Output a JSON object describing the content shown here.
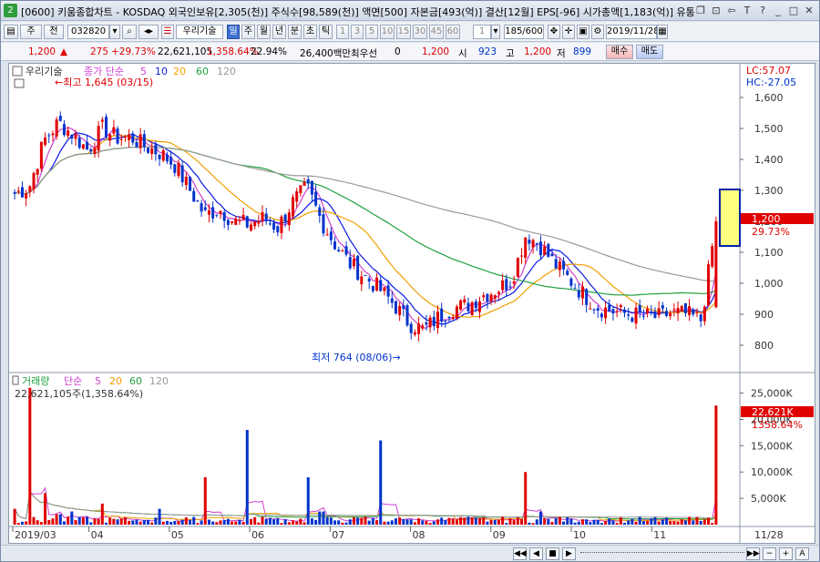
{
  "titlebar": {
    "app_num": "2",
    "title": "[0600] 키움종합차트 - KOSDAQ 외국인보유[2,305(천)] 주식수[98,589(천)] 액면[500] 자본금[493(억)] 결산[12월] EPS[-96] 시가총액[1,183(억)] 유통비율",
    "controls": [
      "❐",
      "⊡",
      "⇦",
      "T",
      "?",
      "_",
      "□",
      "✕"
    ]
  },
  "toolbar1": {
    "mode": "주",
    "prev": "전",
    "code": "032820",
    "group_label": "우리기술",
    "periods": [
      "일",
      "주",
      "월",
      "년",
      "분",
      "초",
      "틱"
    ],
    "minutes": [
      "1",
      "3",
      "5",
      "10",
      "15",
      "30",
      "45",
      "60"
    ],
    "count_select": "1",
    "count": "185/600",
    "date": "2019/11/28",
    "buy": "매수",
    "sell": "매도"
  },
  "toolbar2": {
    "price": "1,200",
    "change": "275",
    "change_pct": "+29.73%",
    "volume": "22,621,105",
    "volume_pct": "1,358.64%",
    "turnover": "22.94%",
    "trade_value": "26,400백만",
    "pref_label": "최우선",
    "pref_value": "0",
    "pref_price": "1,200",
    "open_label": "시",
    "open": "923",
    "high_label": "고",
    "high": "1,200",
    "low_label": "저",
    "low": "899"
  },
  "price_panel": {
    "name": "우리기술",
    "ma_label": "종가 단순",
    "ma_periods": [
      "5",
      "10",
      "20",
      "60",
      "120"
    ],
    "lc": "LC:57.07",
    "hc": "HC:-27.05",
    "high_note": "←최고 1,645 (03/15)",
    "low_note": "최저 764 (08/06)→",
    "current_price_label": "1,200",
    "current_pct_label": "29.73%",
    "y_ticks": [
      "1,600",
      "1,500",
      "1,400",
      "1,300",
      "1,200",
      "1,100",
      "1,000",
      "900",
      "800"
    ]
  },
  "volume_panel": {
    "name": "거래량",
    "ma_label": "단순",
    "ma_periods": [
      "5",
      "20",
      "60",
      "120"
    ],
    "summary": "22,621,105주(1,358.64%)",
    "current_label": "22,621K",
    "current_pct": "1358.64%",
    "y_ticks": [
      "25,000K",
      "20,000K",
      "15,000K",
      "10,000K",
      "5,000K"
    ]
  },
  "x_axis": {
    "labels": [
      "2019/03",
      "04",
      "05",
      "06",
      "07",
      "08",
      "09",
      "10",
      "11"
    ],
    "right_label": "11/28"
  },
  "colors": {
    "up": "#e00000",
    "down": "#0033cc",
    "ma5": "#0a1ae0",
    "ma10": "#d040d0",
    "ma20": "#f0a000",
    "ma60": "#20a040",
    "ma120": "#999999"
  },
  "scrollbar": {
    "buttons": [
      "◀◀",
      "◀",
      "■",
      "▶",
      "▶▶",
      "−",
      "+",
      "A"
    ]
  },
  "chart_data": {
    "type": "candlestick",
    "title": "우리기술",
    "x_range": [
      "2019/03",
      "2019/11/28"
    ],
    "ylim": [
      750,
      1650
    ],
    "notable": [
      {
        "label": "최고",
        "value": 1645,
        "date": "03/15"
      },
      {
        "label": "최저",
        "value": 764,
        "date": "08/06"
      },
      {
        "label": "current",
        "value": 1200,
        "date": "11/28"
      }
    ],
    "close_series": [
      1290,
      1310,
      1460,
      1520,
      1480,
      1430,
      1500,
      1470,
      1470,
      1440,
      1420,
      1380,
      1300,
      1220,
      1240,
      1200,
      1190,
      1210,
      1180,
      1260,
      1310,
      1200,
      1120,
      1060,
      1020,
      980,
      930,
      870,
      850,
      890,
      920,
      930,
      960,
      980,
      1010,
      1160,
      1120,
      1060,
      1010,
      960,
      920,
      910,
      900,
      895,
      890,
      905,
      900,
      880,
      1200
    ],
    "volume_k": [
      3000,
      26000,
      6000,
      2000,
      2500,
      1500,
      4000,
      1000,
      800,
      900,
      3000,
      700,
      900,
      9000,
      800,
      600,
      18000,
      1500,
      1200,
      800,
      9000,
      2500,
      800,
      1000,
      1500,
      16000,
      1200,
      1000,
      800,
      1000,
      1100,
      1500,
      1400,
      900,
      1200,
      10000,
      2500,
      1200,
      1100,
      1000,
      900,
      800,
      800,
      700,
      600,
      700,
      800,
      700,
      22621
    ]
  }
}
